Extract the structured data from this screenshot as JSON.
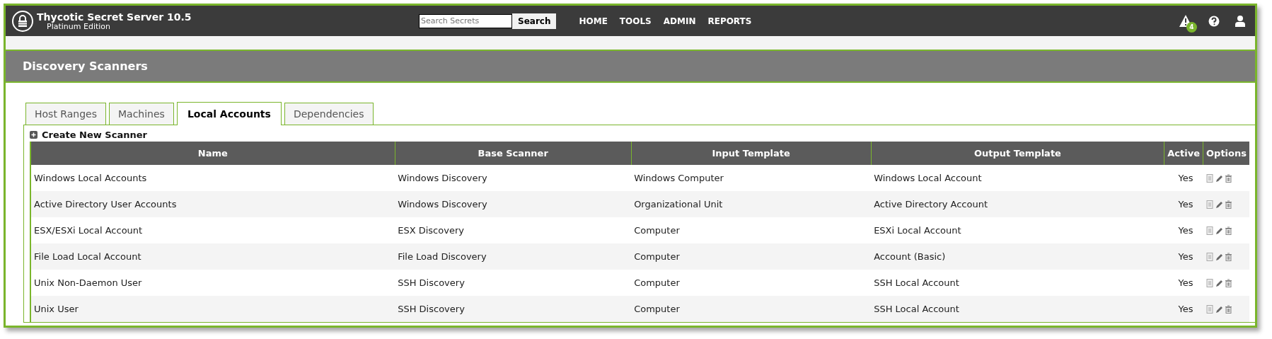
{
  "app": {
    "title": "Thycotic Secret Server 10.5",
    "edition": "Platinum Edition"
  },
  "search": {
    "placeholder": "Search Secrets",
    "button": "Search"
  },
  "nav": [
    "HOME",
    "TOOLS",
    "ADMIN",
    "REPORTS"
  ],
  "alerts": {
    "badge": "4"
  },
  "page_title": "Discovery Scanners",
  "tabs": [
    {
      "label": "Host Ranges",
      "selected": false
    },
    {
      "label": "Machines",
      "selected": false
    },
    {
      "label": "Local Accounts",
      "selected": true
    },
    {
      "label": "Dependencies",
      "selected": false
    }
  ],
  "create_link": "Create New Scanner",
  "table": {
    "columns": [
      "Name",
      "Base Scanner",
      "Input Template",
      "Output Template",
      "Active",
      "Options"
    ],
    "rows": [
      {
        "name": "Windows Local Accounts",
        "base_scanner": "Windows Discovery",
        "input_template": "Windows Computer",
        "output_template": "Windows Local Account",
        "active": "Yes"
      },
      {
        "name": "Active Directory User Accounts",
        "base_scanner": "Windows Discovery",
        "input_template": "Organizational Unit",
        "output_template": "Active Directory Account",
        "active": "Yes"
      },
      {
        "name": "ESX/ESXi Local Account",
        "base_scanner": "ESX Discovery",
        "input_template": "Computer",
        "output_template": "ESXi Local Account",
        "active": "Yes"
      },
      {
        "name": "File Load Local Account",
        "base_scanner": "File Load Discovery",
        "input_template": "Computer",
        "output_template": "Account (Basic)",
        "active": "Yes"
      },
      {
        "name": "Unix Non-Daemon User",
        "base_scanner": "SSH Discovery",
        "input_template": "Computer",
        "output_template": "SSH Local Account",
        "active": "Yes"
      },
      {
        "name": "Unix User",
        "base_scanner": "SSH Discovery",
        "input_template": "Computer",
        "output_template": "SSH Local Account",
        "active": "Yes"
      }
    ]
  }
}
